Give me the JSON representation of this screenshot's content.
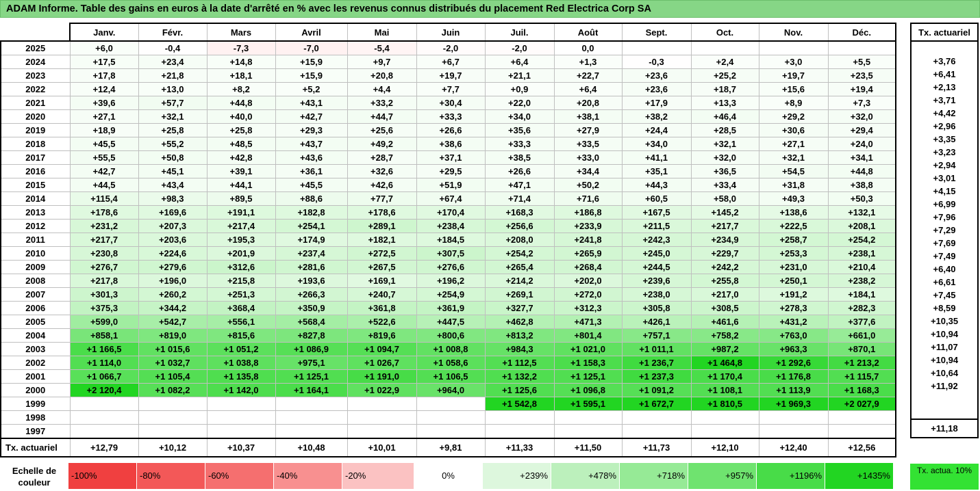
{
  "title": "ADAM Informe. Table des gains en euros à la date d'arrêté en % avec les revenus connus distribués du placement Red Electrica Corp SA",
  "months": [
    "Janv.",
    "Févr.",
    "Mars",
    "Avril",
    "Mai",
    "Juin",
    "Juil.",
    "Août",
    "Sept.",
    "Oct.",
    "Nov.",
    "Déc."
  ],
  "tx_header": "Tx. actuariel",
  "rows": [
    {
      "year": "2025",
      "values": [
        "+6,0",
        "-0,4",
        "-7,3",
        "-7,0",
        "-5,4",
        "-2,0",
        "-2,0",
        "0,0",
        "",
        "",
        "",
        ""
      ],
      "tx": ""
    },
    {
      "year": "2024",
      "values": [
        "+17,5",
        "+23,4",
        "+14,8",
        "+15,9",
        "+9,7",
        "+6,7",
        "+6,4",
        "+1,3",
        "-0,3",
        "+2,4",
        "+3,0",
        "+5,5"
      ],
      "tx": "+3,76"
    },
    {
      "year": "2023",
      "values": [
        "+17,8",
        "+21,8",
        "+18,1",
        "+15,9",
        "+20,8",
        "+19,7",
        "+21,1",
        "+22,7",
        "+23,6",
        "+25,2",
        "+19,7",
        "+23,5"
      ],
      "tx": "+6,41"
    },
    {
      "year": "2022",
      "values": [
        "+12,4",
        "+13,0",
        "+8,2",
        "+5,2",
        "+4,4",
        "+7,7",
        "+0,9",
        "+6,4",
        "+23,6",
        "+18,7",
        "+15,6",
        "+19,4"
      ],
      "tx": "+2,13"
    },
    {
      "year": "2021",
      "values": [
        "+39,6",
        "+57,7",
        "+44,8",
        "+43,1",
        "+33,2",
        "+30,4",
        "+22,0",
        "+20,8",
        "+17,9",
        "+13,3",
        "+8,9",
        "+7,3"
      ],
      "tx": "+3,71"
    },
    {
      "year": "2020",
      "values": [
        "+27,1",
        "+32,1",
        "+40,0",
        "+42,7",
        "+44,7",
        "+33,3",
        "+34,0",
        "+38,1",
        "+38,2",
        "+46,4",
        "+29,2",
        "+32,0"
      ],
      "tx": "+4,42"
    },
    {
      "year": "2019",
      "values": [
        "+18,9",
        "+25,8",
        "+25,8",
        "+29,3",
        "+25,6",
        "+26,6",
        "+35,6",
        "+27,9",
        "+24,4",
        "+28,5",
        "+30,6",
        "+29,4"
      ],
      "tx": "+2,96"
    },
    {
      "year": "2018",
      "values": [
        "+45,5",
        "+55,2",
        "+48,5",
        "+43,7",
        "+49,2",
        "+38,6",
        "+33,3",
        "+33,5",
        "+34,0",
        "+32,1",
        "+27,1",
        "+24,0"
      ],
      "tx": "+3,35"
    },
    {
      "year": "2017",
      "values": [
        "+55,5",
        "+50,8",
        "+42,8",
        "+43,6",
        "+28,7",
        "+37,1",
        "+38,5",
        "+33,0",
        "+41,1",
        "+32,0",
        "+32,1",
        "+34,1"
      ],
      "tx": "+3,23"
    },
    {
      "year": "2016",
      "values": [
        "+42,7",
        "+45,1",
        "+39,1",
        "+36,1",
        "+32,6",
        "+29,5",
        "+26,6",
        "+34,4",
        "+35,1",
        "+36,5",
        "+54,5",
        "+44,8"
      ],
      "tx": "+2,94"
    },
    {
      "year": "2015",
      "values": [
        "+44,5",
        "+43,4",
        "+44,1",
        "+45,5",
        "+42,6",
        "+51,9",
        "+47,1",
        "+50,2",
        "+44,3",
        "+33,4",
        "+31,8",
        "+38,8"
      ],
      "tx": "+3,01"
    },
    {
      "year": "2014",
      "values": [
        "+115,4",
        "+98,3",
        "+89,5",
        "+88,6",
        "+77,7",
        "+67,4",
        "+71,4",
        "+71,6",
        "+60,5",
        "+58,0",
        "+49,3",
        "+50,3"
      ],
      "tx": "+4,15"
    },
    {
      "year": "2013",
      "values": [
        "+178,6",
        "+169,6",
        "+191,1",
        "+182,8",
        "+178,6",
        "+170,4",
        "+168,3",
        "+186,8",
        "+167,5",
        "+145,2",
        "+138,6",
        "+132,1"
      ],
      "tx": "+6,99"
    },
    {
      "year": "2012",
      "values": [
        "+231,2",
        "+207,3",
        "+217,4",
        "+254,1",
        "+289,1",
        "+238,4",
        "+256,6",
        "+233,9",
        "+211,5",
        "+217,7",
        "+222,5",
        "+208,1"
      ],
      "tx": "+7,96"
    },
    {
      "year": "2011",
      "values": [
        "+217,7",
        "+203,6",
        "+195,3",
        "+174,9",
        "+182,1",
        "+184,5",
        "+208,0",
        "+241,8",
        "+242,3",
        "+234,9",
        "+258,7",
        "+254,2"
      ],
      "tx": "+7,29"
    },
    {
      "year": "2010",
      "values": [
        "+230,8",
        "+224,6",
        "+201,9",
        "+237,4",
        "+272,5",
        "+307,5",
        "+254,2",
        "+265,9",
        "+245,0",
        "+229,7",
        "+253,3",
        "+238,1"
      ],
      "tx": "+7,69"
    },
    {
      "year": "2009",
      "values": [
        "+276,7",
        "+279,6",
        "+312,6",
        "+281,6",
        "+267,5",
        "+276,6",
        "+265,4",
        "+268,4",
        "+244,5",
        "+242,2",
        "+231,0",
        "+210,4"
      ],
      "tx": "+7,49"
    },
    {
      "year": "2008",
      "values": [
        "+217,8",
        "+196,0",
        "+215,8",
        "+193,6",
        "+169,1",
        "+196,2",
        "+214,2",
        "+202,0",
        "+239,6",
        "+255,8",
        "+250,1",
        "+238,2"
      ],
      "tx": "+6,40"
    },
    {
      "year": "2007",
      "values": [
        "+301,3",
        "+260,2",
        "+251,3",
        "+266,3",
        "+240,7",
        "+254,9",
        "+269,1",
        "+272,0",
        "+238,0",
        "+217,0",
        "+191,2",
        "+184,1"
      ],
      "tx": "+6,61"
    },
    {
      "year": "2006",
      "values": [
        "+375,3",
        "+344,2",
        "+368,4",
        "+350,9",
        "+361,8",
        "+361,9",
        "+327,7",
        "+312,3",
        "+305,8",
        "+308,5",
        "+278,3",
        "+282,3"
      ],
      "tx": "+7,45"
    },
    {
      "year": "2005",
      "values": [
        "+599,0",
        "+542,7",
        "+556,1",
        "+568,4",
        "+522,6",
        "+447,5",
        "+462,8",
        "+471,3",
        "+426,1",
        "+461,6",
        "+431,2",
        "+377,6"
      ],
      "tx": "+8,59"
    },
    {
      "year": "2004",
      "values": [
        "+858,1",
        "+819,0",
        "+815,6",
        "+827,8",
        "+819,6",
        "+800,6",
        "+813,2",
        "+801,4",
        "+757,1",
        "+758,2",
        "+763,0",
        "+661,0"
      ],
      "tx": "+10,35"
    },
    {
      "year": "2003",
      "values": [
        "+1 166,5",
        "+1 015,6",
        "+1 051,2",
        "+1 086,9",
        "+1 094,7",
        "+1 008,8",
        "+984,3",
        "+1 021,0",
        "+1 011,1",
        "+987,2",
        "+963,3",
        "+870,1"
      ],
      "tx": "+10,94"
    },
    {
      "year": "2002",
      "values": [
        "+1 114,0",
        "+1 032,7",
        "+1 038,8",
        "+975,1",
        "+1 026,7",
        "+1 058,6",
        "+1 112,5",
        "+1 158,3",
        "+1 236,7",
        "+1 464,8",
        "+1 292,6",
        "+1 213,2"
      ],
      "tx": "+11,07"
    },
    {
      "year": "2001",
      "values": [
        "+1 066,7",
        "+1 105,4",
        "+1 135,8",
        "+1 125,1",
        "+1 191,0",
        "+1 106,5",
        "+1 132,2",
        "+1 125,1",
        "+1 237,3",
        "+1 170,4",
        "+1 176,8",
        "+1 115,7"
      ],
      "tx": "+10,94"
    },
    {
      "year": "2000",
      "values": [
        "+2 120,4",
        "+1 082,2",
        "+1 142,0",
        "+1 164,1",
        "+1 022,9",
        "+964,0",
        "+1 125,6",
        "+1 096,8",
        "+1 091,2",
        "+1 108,1",
        "+1 113,9",
        "+1 168,3"
      ],
      "tx": "+10,64"
    },
    {
      "year": "1999",
      "values": [
        "",
        "",
        "",
        "",
        "",
        "",
        "+1 542,8",
        "+1 595,1",
        "+1 672,7",
        "+1 810,5",
        "+1 969,3",
        "+2 027,9"
      ],
      "tx": "+11,92"
    },
    {
      "year": "1998",
      "values": [
        "",
        "",
        "",
        "",
        "",
        "",
        "",
        "",
        "",
        "",
        "",
        ""
      ],
      "tx": ""
    },
    {
      "year": "1997",
      "values": [
        "",
        "",
        "",
        "",
        "",
        "",
        "",
        "",
        "",
        "",
        "",
        ""
      ],
      "tx": ""
    }
  ],
  "footer": {
    "label": "Tx. actuariel",
    "values": [
      "+12,79",
      "+10,12",
      "+10,37",
      "+10,48",
      "+10,01",
      "+9,81",
      "+11,33",
      "+11,50",
      "+11,73",
      "+12,10",
      "+12,40",
      "+12,56"
    ],
    "tx": "+11,18"
  },
  "legend": {
    "label": "Echelle de couleur",
    "items": [
      {
        "text": "-100%",
        "color": "#f04040",
        "kind": "neg"
      },
      {
        "text": "-80%",
        "color": "#f35858",
        "kind": "neg"
      },
      {
        "text": "-60%",
        "color": "#f56f6f",
        "kind": "neg"
      },
      {
        "text": "-40%",
        "color": "#f89090",
        "kind": "neg"
      },
      {
        "text": "-20%",
        "color": "#fbc2c2",
        "kind": "neg"
      },
      {
        "text": "0%",
        "color": "#ffffff",
        "kind": "zero"
      },
      {
        "text": "+239%",
        "color": "#ddf7dd",
        "kind": "pos"
      },
      {
        "text": "+478%",
        "color": "#bcf0bc",
        "kind": "pos"
      },
      {
        "text": "+718%",
        "color": "#96ea96",
        "kind": "pos"
      },
      {
        "text": "+957%",
        "color": "#6fe36f",
        "kind": "pos"
      },
      {
        "text": "+1196%",
        "color": "#48dc48",
        "kind": "pos"
      },
      {
        "text": "+1435%",
        "color": "#22d522",
        "kind": "pos"
      }
    ],
    "tx10_text": "Tx. actua. 10%",
    "tx10_color": "#33e233"
  }
}
